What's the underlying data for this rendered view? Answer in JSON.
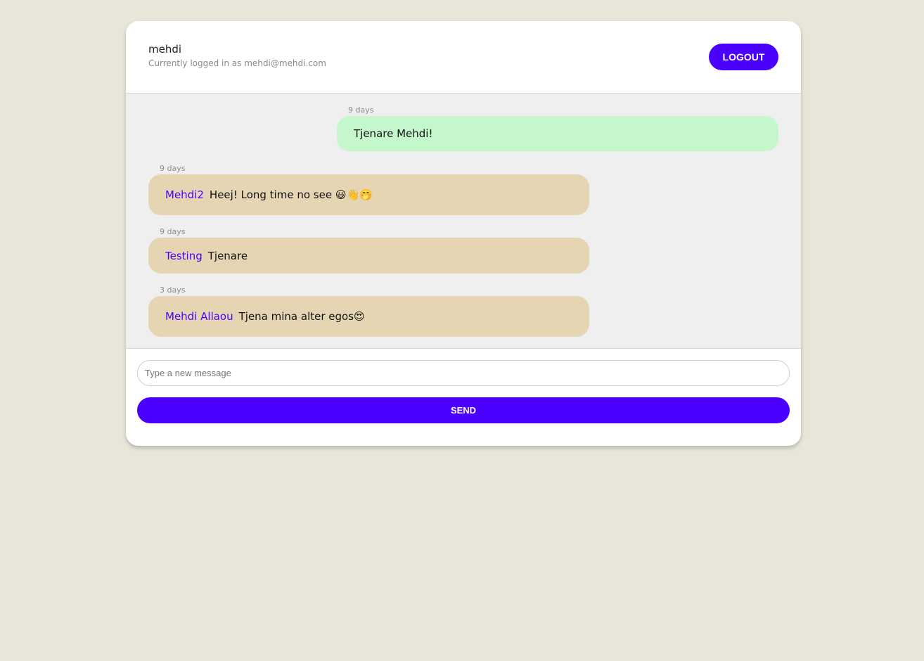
{
  "header": {
    "user_name": "mehdi",
    "logged_in_text": "Currently logged in as mehdi@mehdi.com",
    "logout_label": "LOGOUT"
  },
  "messages": [
    {
      "time": "9 days",
      "author": "",
      "text": "Tjenare Mehdi!",
      "own": true
    },
    {
      "time": "9 days",
      "author": "Mehdi2",
      "text": "Heej! Long time no see 😃👋🤭",
      "own": false
    },
    {
      "time": "9 days",
      "author": "Testing",
      "text": "Tjenare",
      "own": false
    },
    {
      "time": "3 days",
      "author": "Mehdi Allaou",
      "text": "Tjena mina alter egos😍",
      "own": false
    }
  ],
  "composer": {
    "placeholder": "Type a new message",
    "value": "",
    "send_label": "SEND"
  },
  "colors": {
    "accent": "#4b00ff",
    "own_bubble": "#c4f7cb",
    "other_bubble": "#e5d5b3",
    "page_background": "#e8e6d9"
  }
}
